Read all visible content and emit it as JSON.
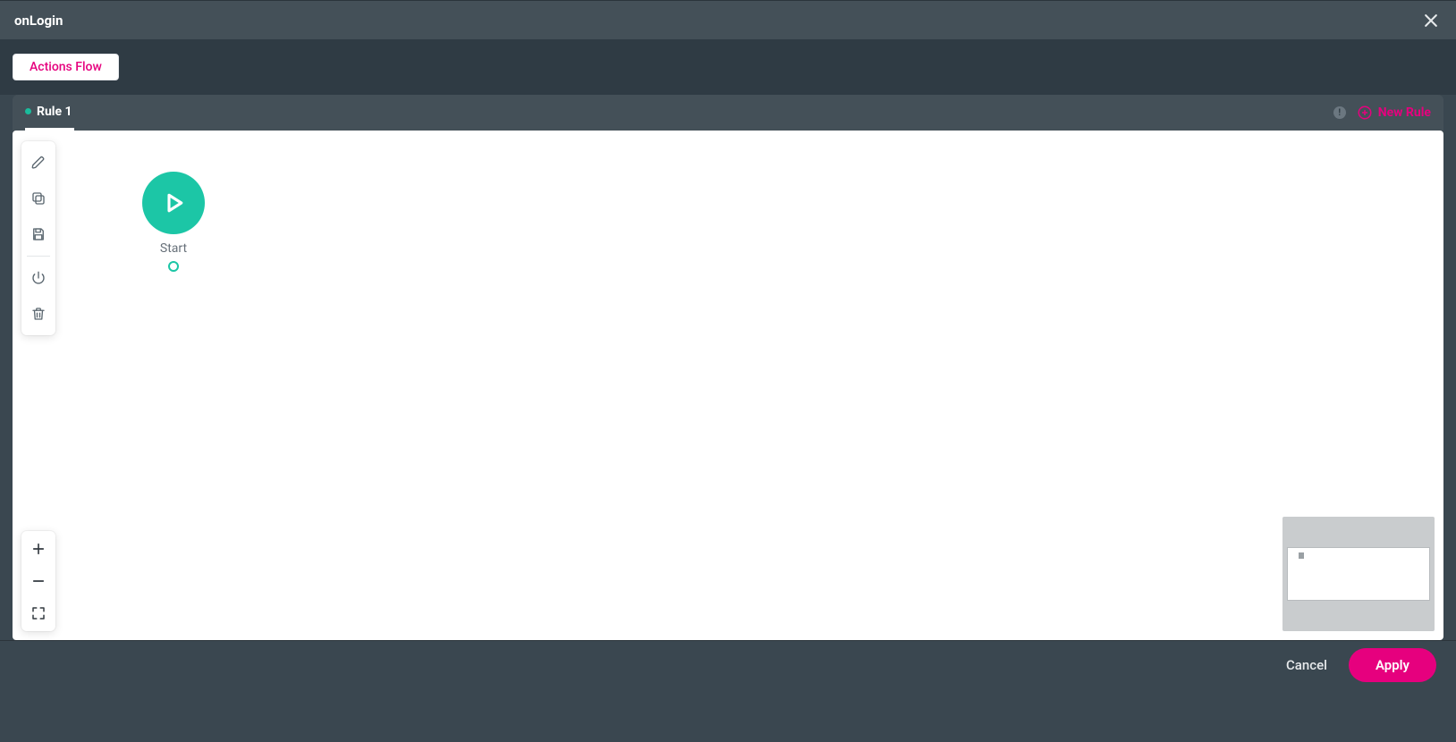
{
  "header": {
    "title": "onLogin"
  },
  "subheader": {
    "actions_flow_label": "Actions Flow"
  },
  "rulebar": {
    "active_tab_label": "Rule 1",
    "new_rule_label": "New Rule",
    "badge_count": "!"
  },
  "canvas": {
    "start_label": "Start"
  },
  "footer": {
    "cancel_label": "Cancel",
    "apply_label": "Apply"
  },
  "colors": {
    "accent_pink": "#e6007e",
    "accent_teal": "#1cc6a6",
    "bg_dark": "#3a4750",
    "bg_darker": "#2f3b44",
    "bg_mid": "#445058"
  }
}
